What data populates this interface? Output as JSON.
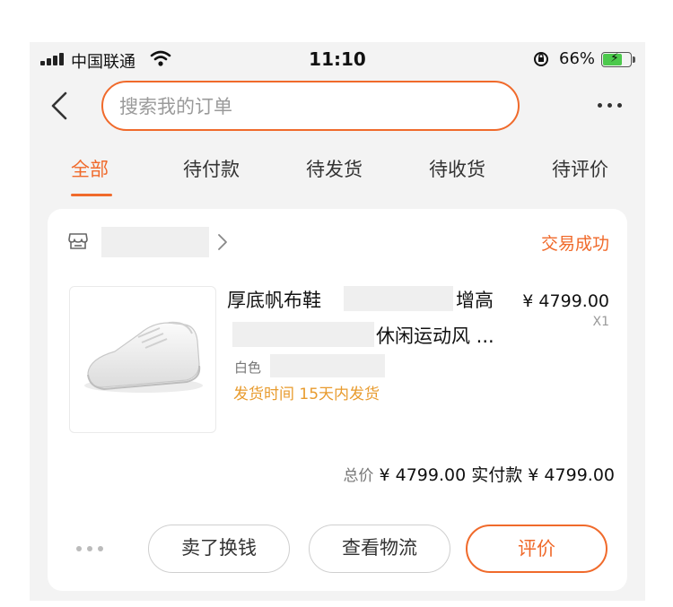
{
  "status_bar": {
    "carrier": "中国联通",
    "time": "11:10",
    "battery_pct": "66%",
    "battery_level": 0.66,
    "battery_color": "#4cc94c"
  },
  "header": {
    "search_placeholder": "搜索我的订单",
    "accent_color": "#f06a2b"
  },
  "tabs": [
    {
      "label": "全部",
      "active": true
    },
    {
      "label": "待付款",
      "active": false
    },
    {
      "label": "待发货",
      "active": false
    },
    {
      "label": "待收货",
      "active": false
    },
    {
      "label": "待评价",
      "active": false
    }
  ],
  "order": {
    "status": "交易成功",
    "product": {
      "title_part1": "厚底帆布鞋",
      "title_part2": "增高",
      "title_line2": "休闲运动风 ...",
      "price": "¥ 4799.00",
      "quantity": "X1",
      "variant": "白色",
      "delivery": "发货时间 15天内发货"
    },
    "totals": {
      "total_label": "总价",
      "total_value": "¥ 4799.00",
      "paid_label": "实付款",
      "paid_value": "¥ 4799.00"
    },
    "actions": {
      "sell": "卖了换钱",
      "logistics": "查看物流",
      "review": "评价"
    }
  }
}
